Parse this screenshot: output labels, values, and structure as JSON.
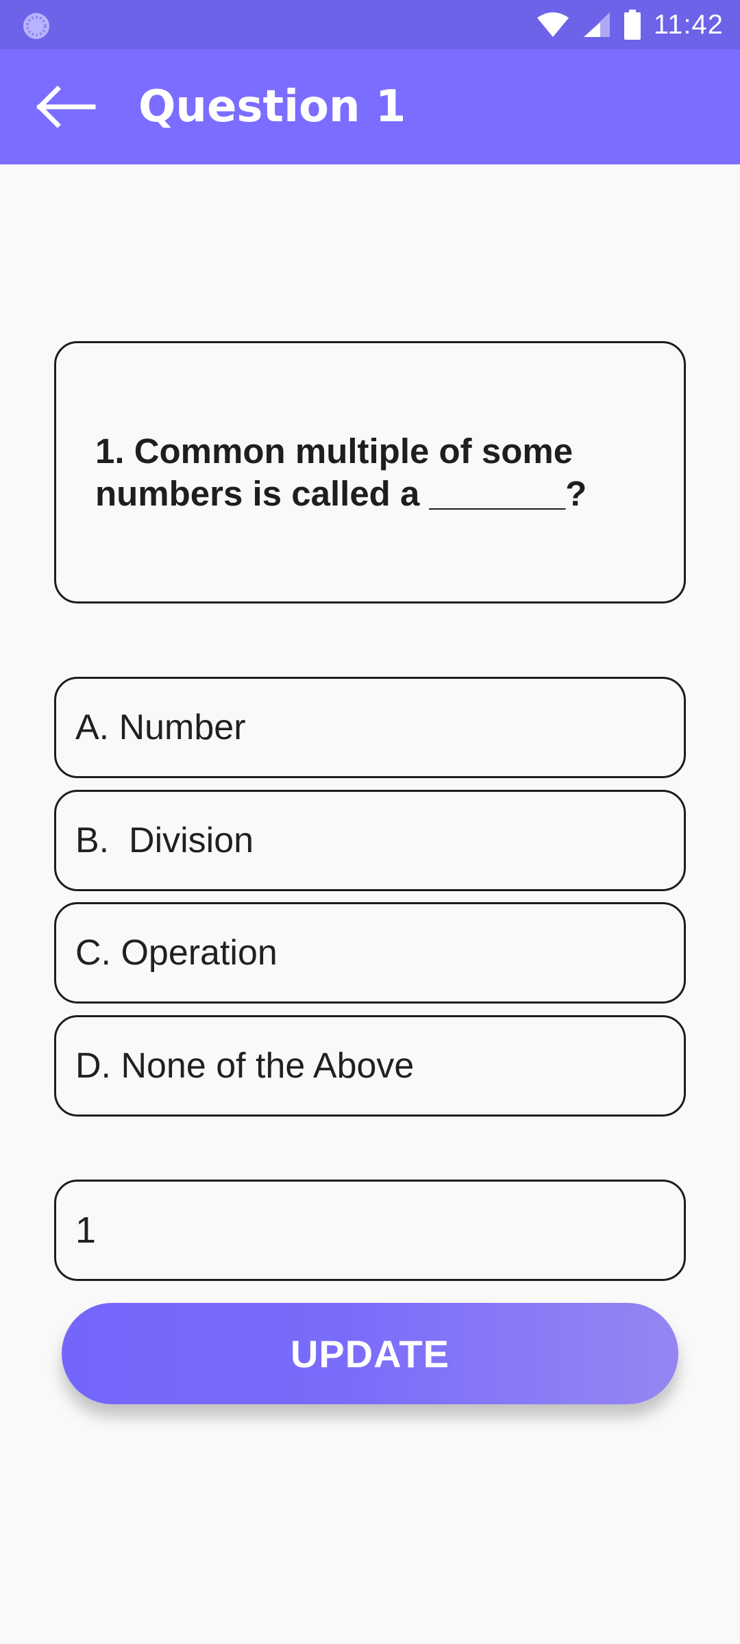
{
  "status_bar": {
    "time": "11:42",
    "icons": [
      "loading-icon",
      "wifi-icon",
      "signal-icon",
      "battery-icon"
    ]
  },
  "app_bar": {
    "title": "Question 1",
    "back_icon": "arrow-back-icon",
    "color": "#7b6dff"
  },
  "question": {
    "text": "1. Common multiple of some\nnumbers is called a _______?"
  },
  "options": [
    {
      "label": "A. Number"
    },
    {
      "label": "B.  Division"
    },
    {
      "label": "C. Operation"
    },
    {
      "label": "D. None of the Above"
    }
  ],
  "answer_input": {
    "value": "1"
  },
  "update_button": {
    "label": "UPDATE"
  },
  "colors": {
    "status_bar": "#6c63e8",
    "accent": "#7b6dff",
    "background": "#f9f9f9",
    "border": "#1c1c1c"
  }
}
